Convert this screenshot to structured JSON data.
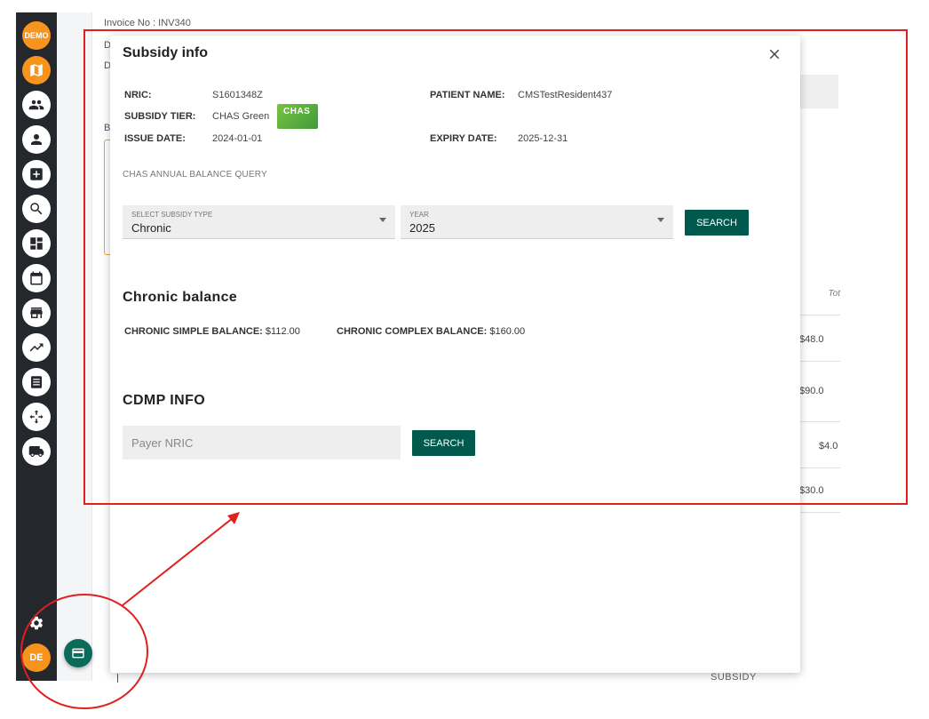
{
  "background": {
    "invoice_no": "Invoice No : INV340",
    "letter_d1": "D",
    "letter_d2": "D",
    "letter_b": "B",
    "table_header": "Tot",
    "amounts": [
      "$48.0",
      "$90.0",
      "$4.0",
      "$30.0"
    ],
    "subsidy_label": "SUBSIDY"
  },
  "rail": {
    "demo_label": "DEMO",
    "avatar_initials": "DE",
    "icons": [
      "map-icon",
      "group-icon",
      "person-icon",
      "medical-add-icon",
      "search-icon",
      "dashboard-icon",
      "calendar-icon",
      "store-icon",
      "trending-icon",
      "list-icon",
      "move-icon",
      "truck-icon",
      "gear-icon"
    ]
  },
  "modal": {
    "title": "Subsidy info",
    "nric_label": "NRIC:",
    "nric_value": "S1601348Z",
    "patient_label": "PATIENT NAME:",
    "patient_value": "CMSTestResident437",
    "tier_label": "SUBSIDY TIER:",
    "tier_value": "CHAS Green",
    "chas_badge": "CHAS",
    "issue_label": "ISSUE DATE:",
    "issue_value": "2024-01-01",
    "expiry_label": "EXPIRY DATE:",
    "expiry_value": "2025-12-31",
    "query_caption": "CHAS ANNUAL BALANCE QUERY",
    "subsidy_type": {
      "label": "SELECT SUBSIDY TYPE",
      "value": "Chronic"
    },
    "year": {
      "label": "YEAR",
      "value": "2025"
    },
    "search_label": "SEARCH",
    "balance_heading": "Chronic balance",
    "simple_label": "CHRONIC SIMPLE BALANCE:",
    "simple_value": "$112.00",
    "complex_label": "CHRONIC COMPLEX BALANCE:",
    "complex_value": "$160.00",
    "cdmp_heading": "CDMP INFO",
    "payer_placeholder": "Payer NRIC",
    "cdmp_search_label": "SEARCH"
  },
  "colors": {
    "accent_green": "#00594c",
    "rail_bg": "#24272c",
    "rail_orange": "#f7941d",
    "annotation_red": "#e01f1f",
    "chas_green": "#5aae3e"
  }
}
